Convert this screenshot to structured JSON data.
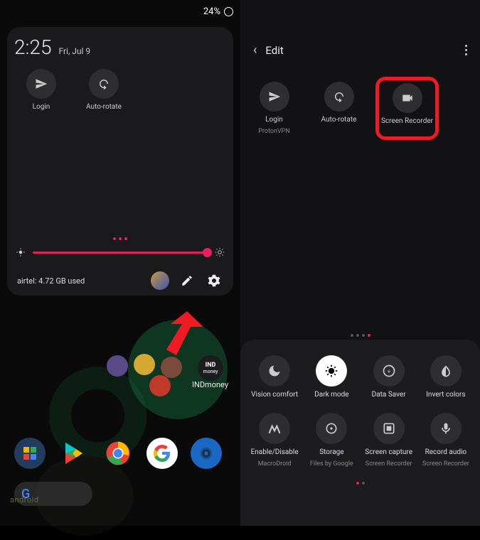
{
  "statusBar": {
    "battery": "24%"
  },
  "clock": {
    "time": "2:25",
    "date": "Fri, Jul 9"
  },
  "leftTiles": [
    {
      "label": "Login"
    },
    {
      "label": "Auto-rotate"
    }
  ],
  "dataUsage": "airtel: 4.72 GB used",
  "homeApps": {
    "indmoney": "INDmoney"
  },
  "watermark": "android",
  "editHeader": {
    "title": "Edit"
  },
  "editTiles": [
    {
      "label": "Login",
      "sub": "ProtonVPN"
    },
    {
      "label": "Auto-rotate",
      "sub": ""
    },
    {
      "label": "Screen Recorder",
      "sub": ""
    }
  ],
  "bottomRow1": [
    {
      "label": "Vision comfort",
      "sub": ""
    },
    {
      "label": "Dark mode",
      "sub": ""
    },
    {
      "label": "Data Saver",
      "sub": ""
    },
    {
      "label": "Invert colors",
      "sub": ""
    }
  ],
  "bottomRow2": [
    {
      "label": "Enable/Disable",
      "sub": "MacroDroid"
    },
    {
      "label": "Storage",
      "sub": "Files by Google"
    },
    {
      "label": "Screen capture",
      "sub": "Screen Recorder"
    },
    {
      "label": "Record audio",
      "sub": "Screen Recorder"
    }
  ]
}
